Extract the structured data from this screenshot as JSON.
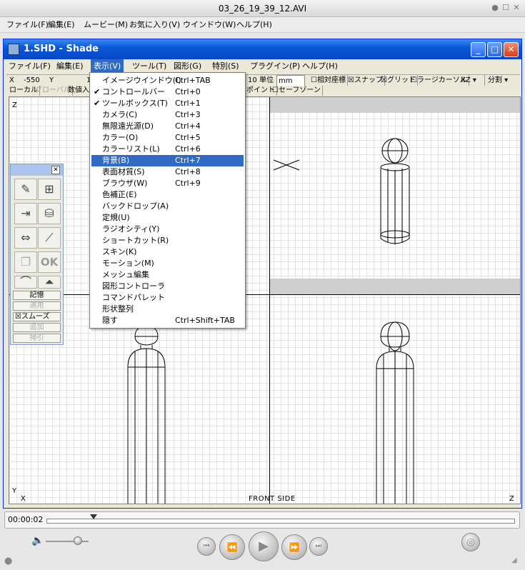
{
  "player": {
    "title": "03_26_19_39_12.AVI",
    "menu": [
      "ファイル(F)",
      "編集(E)",
      "ムービー(M)",
      "お気に入り(V)",
      "ウインドウ(W)",
      "ヘルプ(H)"
    ],
    "timecode": "00:00:02",
    "volume_level": 0.75,
    "playhead_fraction": 0.1
  },
  "shade": {
    "title": "1.SHD - Shade",
    "menu": [
      "ファイル(F)",
      "編集(E)",
      "表示(V)",
      "ツール(T)",
      "図形(G)",
      "特別(S)",
      "プラグイン(P)",
      "ヘルプ(H)"
    ],
    "active_menu": "表示(V)",
    "infobar": {
      "x_label": "X",
      "x_value": "-550",
      "y_label": "Y",
      "y_value": "1",
      "grid_value": "10",
      "unit_label": "単位",
      "unit_value": "mm",
      "relative_coords": "相対座標",
      "snap": "スナップ",
      "grid": "グリッド",
      "large_cursor": "ラージカーソル",
      "plane": "XZ",
      "split": "分割"
    },
    "infobar2": {
      "local": "ローカル",
      "global": "グローバル",
      "numeric": "数値入力",
      "point": "ポイント",
      "safe_zone": "セーフゾーン"
    },
    "view_labels": {
      "z_top": "Z",
      "y_bottom": "Y",
      "x_bottom": "X",
      "front_side": "FRONT SIDE",
      "z_right": "Z"
    }
  },
  "view_menu": {
    "items": [
      {
        "label": "イメージウインドウ(I)",
        "shortcut": "Ctrl+TAB",
        "checked": false,
        "selected": false
      },
      {
        "label": "コントロールバー",
        "shortcut": "Ctrl+0",
        "checked": true,
        "selected": false
      },
      {
        "label": "ツールボックス(T)",
        "shortcut": "Ctrl+1",
        "checked": true,
        "selected": false
      },
      {
        "label": "カメラ(C)",
        "shortcut": "Ctrl+3",
        "checked": false,
        "selected": false
      },
      {
        "label": "無限遠光源(D)",
        "shortcut": "Ctrl+4",
        "checked": false,
        "selected": false
      },
      {
        "label": "カラー(O)",
        "shortcut": "Ctrl+5",
        "checked": false,
        "selected": false
      },
      {
        "label": "カラーリスト(L)",
        "shortcut": "Ctrl+6",
        "checked": false,
        "selected": false
      },
      {
        "label": "背景(B)",
        "shortcut": "Ctrl+7",
        "checked": false,
        "selected": true
      },
      {
        "label": "表面材質(S)",
        "shortcut": "Ctrl+8",
        "checked": false,
        "selected": false
      },
      {
        "label": "ブラウザ(W)",
        "shortcut": "Ctrl+9",
        "checked": false,
        "selected": false
      },
      {
        "label": "色補正(E)",
        "shortcut": "",
        "checked": false,
        "selected": false
      },
      {
        "label": "バックドロップ(A)",
        "shortcut": "",
        "checked": false,
        "selected": false
      },
      {
        "label": "定規(U)",
        "shortcut": "",
        "checked": false,
        "selected": false
      },
      {
        "label": "ラジオシティ(Y)",
        "shortcut": "",
        "checked": false,
        "selected": false
      },
      {
        "label": "ショートカット(R)",
        "shortcut": "",
        "checked": false,
        "selected": false
      },
      {
        "label": "スキン(K)",
        "shortcut": "",
        "checked": false,
        "selected": false
      },
      {
        "label": "モーション(M)",
        "shortcut": "",
        "checked": false,
        "selected": false
      },
      {
        "label": "メッシュ編集",
        "shortcut": "",
        "checked": false,
        "selected": false
      },
      {
        "label": "図形コントローラ",
        "shortcut": "",
        "checked": false,
        "selected": false
      },
      {
        "label": "コマンドパレット",
        "shortcut": "",
        "checked": false,
        "selected": false
      },
      {
        "label": "形状整列",
        "shortcut": "",
        "checked": false,
        "selected": false
      },
      {
        "label": "隠す",
        "shortcut": "Ctrl+Shift+TAB",
        "checked": false,
        "selected": false
      }
    ],
    "check_glyph": "✔"
  },
  "toolbox": {
    "ok_label": "OK",
    "buttons": [
      {
        "label": "記憶",
        "enabled": true
      },
      {
        "label": "適用",
        "enabled": false
      },
      {
        "label": "スムーズ",
        "enabled": true
      },
      {
        "label": "追加",
        "enabled": false
      },
      {
        "label": "掃引",
        "enabled": false
      }
    ],
    "smooth_checkbox_glyph": "☒",
    "icons": [
      "pencil-icon",
      "hierarchy-icon",
      "move-icon",
      "cylinder-icon",
      "scale-icon",
      "line-icon",
      "copy-icon",
      "ok-icon",
      "flat-icon",
      "mountain-icon"
    ]
  },
  "colors": {
    "xp_title_blue": "#0a58d8",
    "selection_blue": "#316ac5",
    "palette_title": "#aac4ec"
  }
}
